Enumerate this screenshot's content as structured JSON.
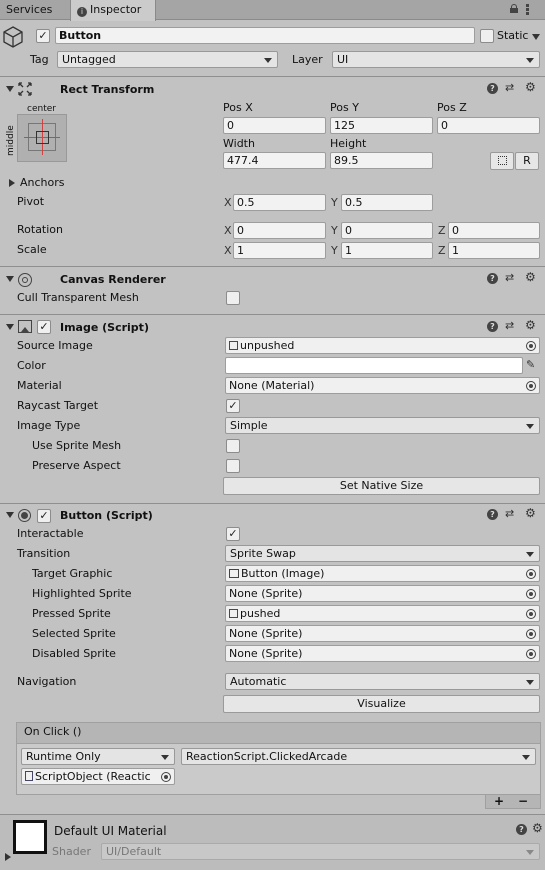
{
  "tabs": {
    "services": "Services",
    "inspector": "Inspector"
  },
  "header": {
    "name": "Button",
    "static_label": "Static",
    "tag_label": "Tag",
    "tag_value": "Untagged",
    "layer_label": "Layer",
    "layer_value": "UI"
  },
  "rect_transform": {
    "title": "Rect Transform",
    "anchor_h": "center",
    "anchor_v": "middle",
    "pos_x_label": "Pos X",
    "pos_y_label": "Pos Y",
    "pos_z_label": "Pos Z",
    "pos_x": "0",
    "pos_y": "125",
    "pos_z": "0",
    "width_label": "Width",
    "height_label": "Height",
    "width": "477.4",
    "height": "89.5",
    "r_button": "R",
    "anchors_label": "Anchors",
    "pivot_label": "Pivot",
    "pivot_x": "0.5",
    "pivot_y": "0.5",
    "rotation_label": "Rotation",
    "rot_x": "0",
    "rot_y": "0",
    "rot_z": "0",
    "scale_label": "Scale",
    "scale_x": "1",
    "scale_y": "1",
    "scale_z": "1",
    "x": "X",
    "y": "Y",
    "z": "Z"
  },
  "canvas_renderer": {
    "title": "Canvas Renderer",
    "cull_label": "Cull Transparent Mesh"
  },
  "image": {
    "title": "Image (Script)",
    "source_label": "Source Image",
    "source_value": "unpushed",
    "color_label": "Color",
    "material_label": "Material",
    "material_value": "None (Material)",
    "raycast_label": "Raycast Target",
    "type_label": "Image Type",
    "type_value": "Simple",
    "sprite_mesh_label": "Use Sprite Mesh",
    "preserve_label": "Preserve Aspect",
    "native_size_button": "Set Native Size"
  },
  "button": {
    "title": "Button (Script)",
    "interactable_label": "Interactable",
    "transition_label": "Transition",
    "transition_value": "Sprite Swap",
    "target_label": "Target Graphic",
    "target_value": "Button (Image)",
    "highlighted_label": "Highlighted Sprite",
    "highlighted_value": "None (Sprite)",
    "pressed_label": "Pressed Sprite",
    "pressed_value": "pushed",
    "selected_label": "Selected Sprite",
    "selected_value": "None (Sprite)",
    "disabled_label": "Disabled Sprite",
    "disabled_value": "None (Sprite)",
    "navigation_label": "Navigation",
    "navigation_value": "Automatic",
    "visualize_button": "Visualize"
  },
  "on_click": {
    "title": "On Click ()",
    "runtime_value": "Runtime Only",
    "function_value": "ReactionScript.ClickedArcade",
    "object_value": "ScriptObject (Reactic",
    "plus": "+",
    "minus": "−"
  },
  "material": {
    "name": "Default UI Material",
    "shader_label": "Shader",
    "shader_value": "UI/Default"
  },
  "colors": {
    "panel": "#c2c2c2",
    "tabbar": "#a5a5a5",
    "field": "#f2f2f2"
  }
}
